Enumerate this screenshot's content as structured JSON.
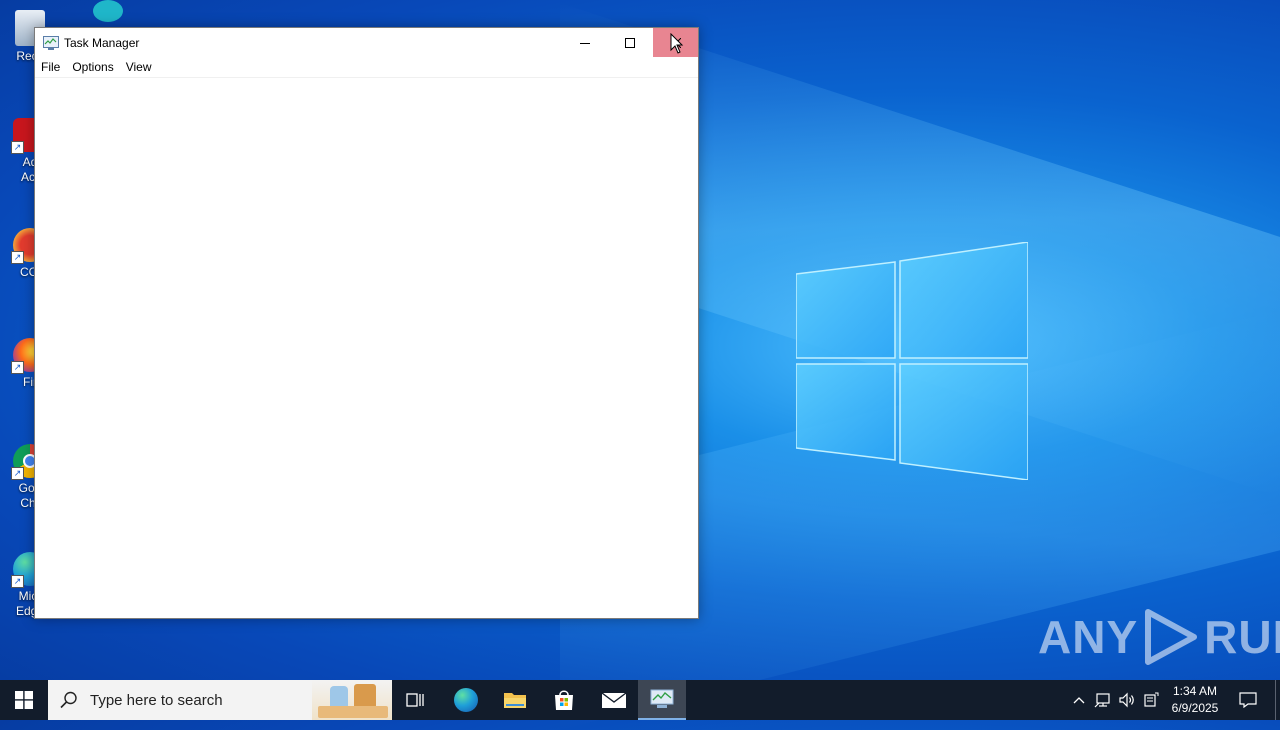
{
  "desktop": {
    "icons": [
      {
        "label": "Recy"
      },
      {
        "label": "Ad Acr"
      },
      {
        "label": "CCl"
      },
      {
        "label": "Fir"
      },
      {
        "label": "Goo Chr"
      },
      {
        "label": "Micr Edge"
      }
    ],
    "watermark": {
      "left": "ANY",
      "right": "RUN"
    }
  },
  "task_manager": {
    "title": "Task Manager",
    "menu": [
      "File",
      "Options",
      "View"
    ]
  },
  "taskbar": {
    "search_placeholder": "Type here to search",
    "clock": {
      "time": "1:34 AM",
      "date": "6/9/2025"
    }
  }
}
